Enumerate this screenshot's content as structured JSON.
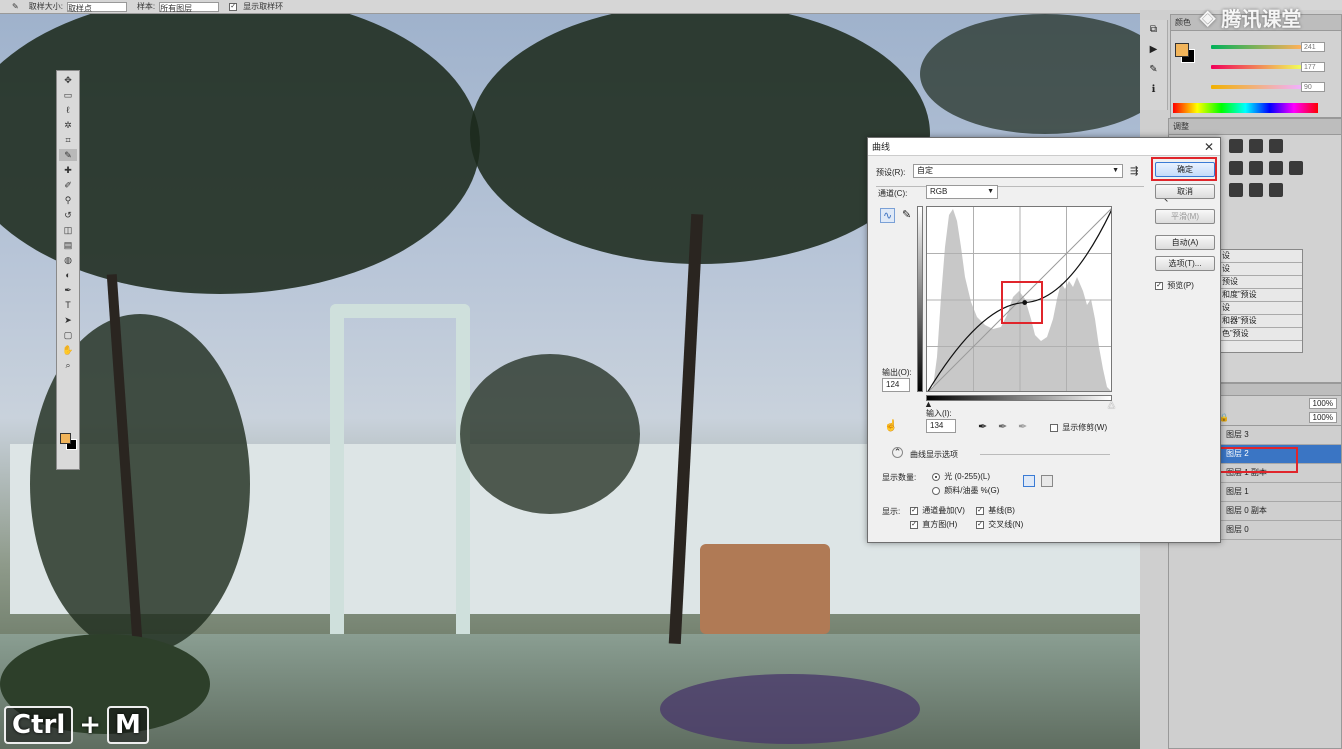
{
  "options_bar": {
    "sample_label": "取样大小:",
    "sample_value": "取样点",
    "sample2_label": "样本:",
    "sample2_value": "所有图层",
    "checkbox_label": "显示取样环"
  },
  "watermark": {
    "text": "腾讯课堂"
  },
  "hotkey": {
    "key1": "Ctrl",
    "plus": "+",
    "key2": "M"
  },
  "color_panel": {
    "tab_label": "颜色",
    "r_value": "241",
    "g_value": "177",
    "b_value": "90",
    "fg_color": "#f1b45a",
    "bg_color": "#000000"
  },
  "adjust_panel": {
    "tab_label": "调整",
    "presets": [
      "设",
      "设",
      "预设",
      "和度”预设",
      "设",
      "和器”预设",
      "色”预设"
    ]
  },
  "layers_panel": {
    "opacity_value": "100%",
    "fill_value": "100%",
    "layers": [
      {
        "name": "图层 3",
        "selected": false
      },
      {
        "name": "图层 2",
        "selected": true
      },
      {
        "name": "图层 1 副本",
        "selected": false
      },
      {
        "name": "图层 1",
        "selected": false
      },
      {
        "name": "图层 0 副本",
        "selected": false
      },
      {
        "name": "图层 0",
        "selected": false
      }
    ]
  },
  "curves_dialog": {
    "title": "曲线",
    "preset_label": "预设(R):",
    "preset_value": "自定",
    "channel_label": "通道(C):",
    "channel_value": "RGB",
    "output_label": "输出(O):",
    "output_value": "124",
    "input_label": "输入(I):",
    "input_value": "134",
    "show_clipping": "显示修剪(W)",
    "display_options": "曲线显示选项",
    "show_amount_label": "显示数量:",
    "light_option": "光 (0-255)(L)",
    "pigment_option": "颜料/油墨 %(G)",
    "show_label": "显示:",
    "opt_channel_overlay": "通道叠加(V)",
    "opt_baseline": "基线(B)",
    "opt_histogram": "直方图(H)",
    "opt_intersection": "交叉线(N)",
    "buttons": {
      "ok": "确定",
      "cancel": "取消",
      "smooth": "平滑(M)",
      "auto": "自动(A)",
      "options": "选项(T)..."
    },
    "preview_label": "预览(P)",
    "curve_point": {
      "input": 134,
      "output": 124
    }
  }
}
